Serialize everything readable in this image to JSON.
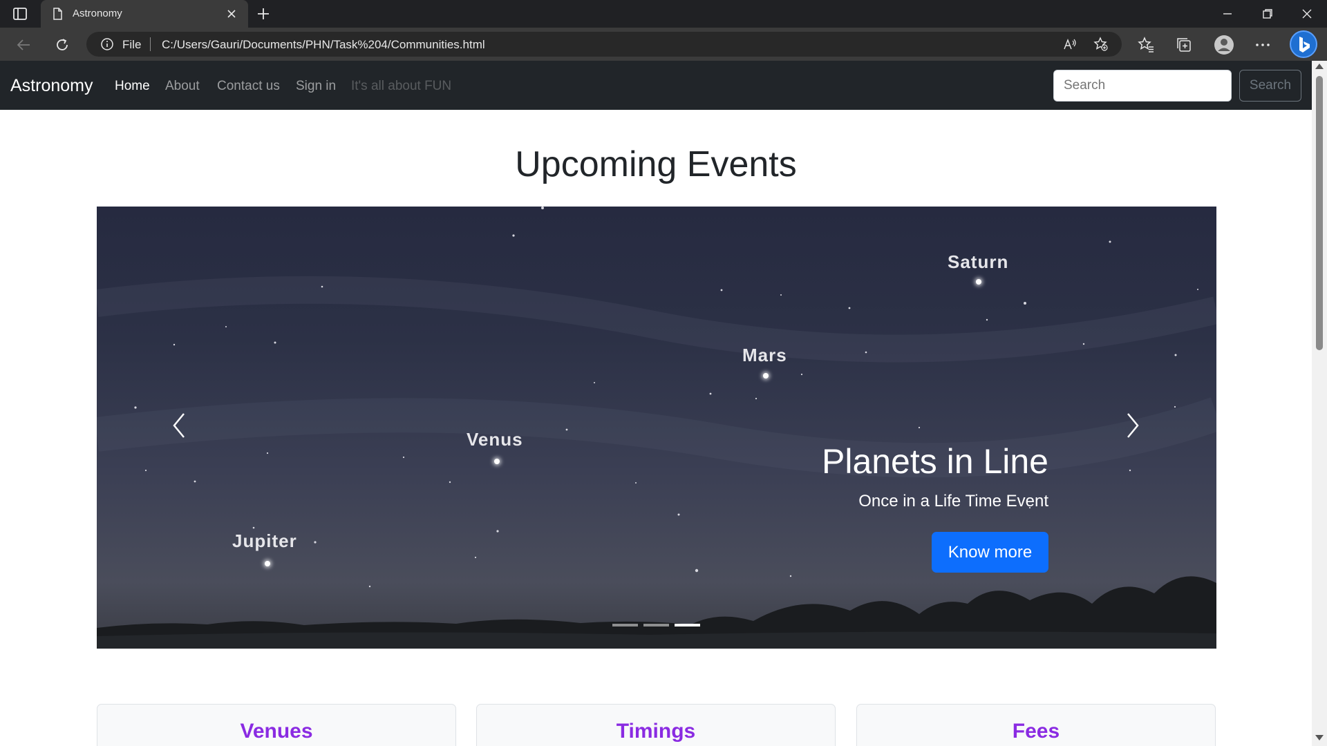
{
  "browser": {
    "tab_title": "Astronomy",
    "address_scheme": "File",
    "url": "C:/Users/Gauri/Documents/PHN/Task%204/Communities.html"
  },
  "navbar": {
    "brand": "Astronomy",
    "links": [
      {
        "label": "Home",
        "state": "active"
      },
      {
        "label": "About",
        "state": "normal"
      },
      {
        "label": "Contact us",
        "state": "normal"
      },
      {
        "label": "Sign in",
        "state": "normal"
      },
      {
        "label": "It's all about FUN",
        "state": "disabled"
      }
    ],
    "search_placeholder": "Search",
    "search_button": "Search"
  },
  "main": {
    "heading": "Upcoming Events",
    "carousel": {
      "planet_labels": [
        "Saturn",
        "Mars",
        "Venus",
        "Jupiter"
      ],
      "caption_title": "Planets in Line",
      "caption_text": "Once in a Life Time Event",
      "button_label": "Know more",
      "slide_count": 3,
      "active_slide": 3
    },
    "cards": [
      {
        "title": "Venues"
      },
      {
        "title": "Timings"
      },
      {
        "title": "Fees"
      }
    ]
  },
  "colors": {
    "navbar_bg": "#212529",
    "primary_button": "#0d6efd",
    "card_title": "#8a2be2"
  }
}
